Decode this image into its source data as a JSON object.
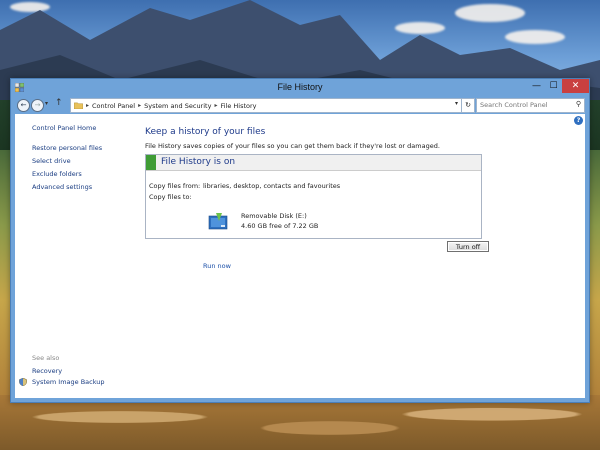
{
  "window": {
    "title": "File History",
    "minimize": "—",
    "maximize": "☐",
    "close": "✕"
  },
  "address": {
    "breadcrumb": [
      "Control Panel",
      "System and Security",
      "File History"
    ],
    "search_placeholder": "Search Control Panel"
  },
  "sidebar": {
    "home": "Control Panel Home",
    "links": [
      "Restore personal files",
      "Select drive",
      "Exclude folders",
      "Advanced settings"
    ],
    "see_also": "See also",
    "see_also_links": [
      "Recovery",
      "System Image Backup"
    ]
  },
  "main": {
    "heading": "Keep a history of your files",
    "subheading": "File History saves copies of your files so you can get them back if they're lost or damaged.",
    "status": "File History is on",
    "copy_from_label": "Copy files from:",
    "copy_from_value": "libraries, desktop, contacts and favourites",
    "copy_to_label": "Copy files to:",
    "drive_name": "Removable Disk (E:)",
    "drive_space": "4.60 GB free of 7.22 GB",
    "run_now": "Run now",
    "turn_off": "Turn off"
  },
  "colors": {
    "title_bar": "#6fa3d9",
    "close_button": "#c94040",
    "status_green": "#3f9c35",
    "heading_blue": "#1e3a8a",
    "link_blue": "#1a3d82"
  },
  "icons": {
    "back": "arrow-left-icon",
    "forward": "arrow-right-icon",
    "up": "arrow-up-icon",
    "folder": "folder-icon",
    "refresh": "refresh-icon",
    "search": "search-icon",
    "help": "help-icon",
    "drive": "removable-drive-icon",
    "shield": "shield-icon"
  }
}
